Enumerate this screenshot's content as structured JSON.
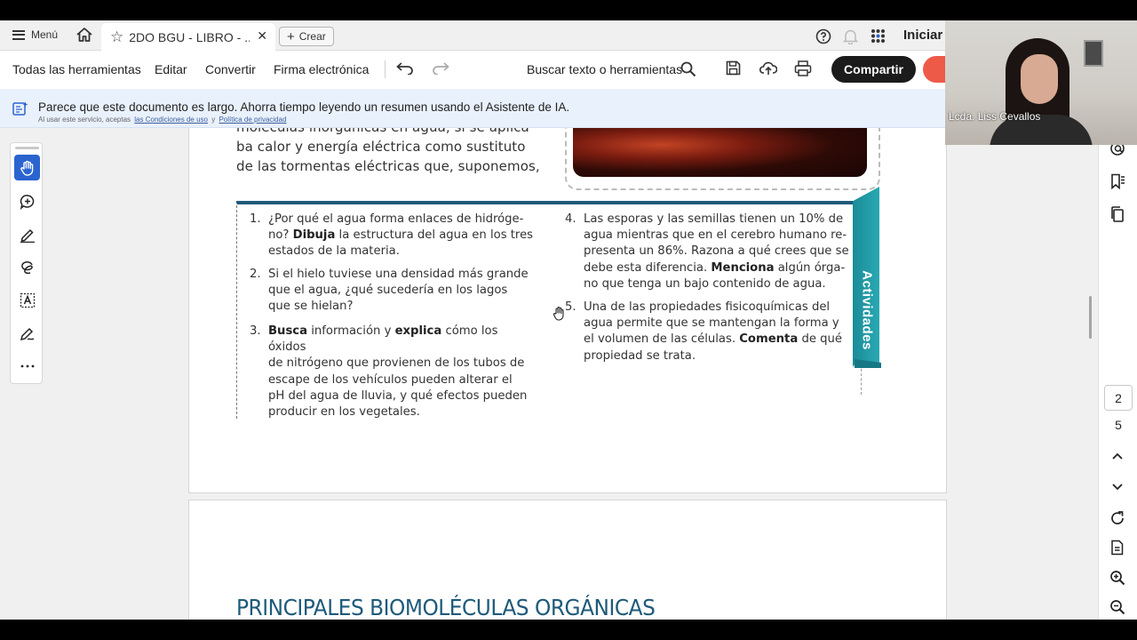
{
  "tabbar": {
    "menu_label": "Menú",
    "tab_title": "2DO BGU - LIBRO - ...",
    "create_label": "Crear",
    "signin_label": "Iniciar"
  },
  "toolbar": {
    "all_tools": "Todas las herramientas",
    "edit": "Editar",
    "convert": "Convertir",
    "esign": "Firma electrónica",
    "search": "Buscar texto o herramientas",
    "share": "Compartir"
  },
  "banner": {
    "message": "Parece que este documento es largo. Ahorra tiempo leyendo un resumen usando el Asistente de IA.",
    "legal_prefix": "Al usar este servicio, aceptas",
    "terms_link": "las Condiciones de uso",
    "legal_and": "y",
    "privacy_link": "Política de privacidad"
  },
  "document": {
    "intro_lines": [
      "moléculas inorgánicas en agua, si se aplica",
      "ba calor y energía eléctrica como sustituto",
      "de las tormentas eléctricas que, suponemos,"
    ],
    "activities_label": "Actividades",
    "questions": [
      {
        "num": "1.",
        "html": "¿Por qué el agua forma enlaces de hidróge-<br>no? <b>Dibuja</b> la estructura del agua en los tres<br>estados de la materia."
      },
      {
        "num": "2.",
        "html": "Si el hielo tuviese una densidad más grande<br>que el agua, ¿qué sucedería en los lagos<br>que se hielan?"
      },
      {
        "num": "3.",
        "html": "<b>Busca</b> información y <b>explica</b> cómo los óxidos<br>de nitrógeno que provienen de los tubos de<br>escape de los vehículos pueden alterar el<br>pH del agua de lluvia, y qué efectos pueden<br>producir en los vegetales."
      },
      {
        "num": "4.",
        "html": "Las esporas y las semillas tienen un 10% de<br>agua mientras que en el cerebro humano re-<br>presenta un 86%. Razona a qué crees que se<br>debe esta diferencia. <b>Menciona</b> algún órga-<br>no que tenga un bajo contenido de agua."
      },
      {
        "num": "5.",
        "html": "Una de las propiedades fisicoquímicas del<br>agua permite que se mantengan la forma y<br>el volumen de las células. <b>Comenta</b> de qué<br>propiedad se trata."
      }
    ],
    "next_page_heading": "PRINCIPALES BIOMOLÉCULAS ORGÁNICAS"
  },
  "pager": {
    "current_page": "2",
    "total_pages": "5"
  },
  "webcam": {
    "name": "Lcda. Liss Cevallos"
  },
  "colors": {
    "accent_blue": "#2a64cf",
    "share_bg": "#1b1b1b",
    "activities_teal": "#29a9b3",
    "heading_blue": "#1e5a7a"
  }
}
